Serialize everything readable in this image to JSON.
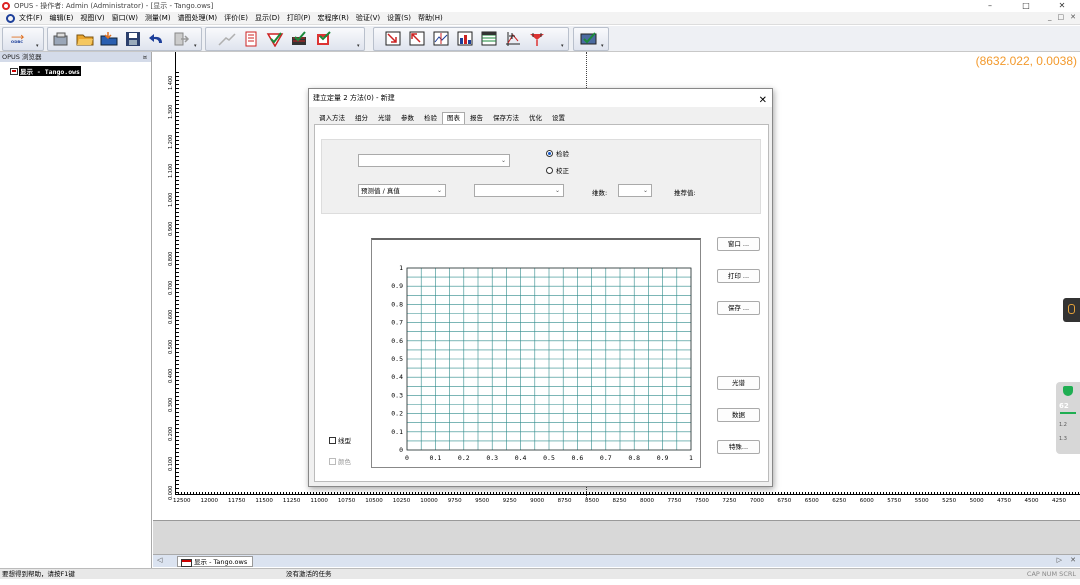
{
  "window": {
    "title": "OPUS - 操作者: Admin  (Administrator) - [显示 - Tango.ows]",
    "controls": [
      "–",
      "□",
      "✕"
    ],
    "mdi_controls": [
      "_",
      "□",
      "✕"
    ]
  },
  "menu": [
    "文件(F)",
    "编辑(E)",
    "视图(V)",
    "窗口(W)",
    "测量(M)",
    "谱图处理(M)",
    "评价(E)",
    "显示(D)",
    "打印(P)",
    "宏程序(R)",
    "验证(V)",
    "设置(S)",
    "帮助(H)"
  ],
  "toolbar": {
    "odbc_label": "ODBC"
  },
  "browser": {
    "header": "OPUS 浏览器",
    "pin": "¤",
    "item": "显示 - Tango.ows"
  },
  "spectrum": {
    "readout": "(8632.022, 0.0038)",
    "y_ticks": [
      "1.400",
      "1.300",
      "1.200",
      "1.100",
      "1.000",
      "0.900",
      "0.800",
      "0.700",
      "0.600",
      "0.500",
      "0.400",
      "0.300",
      "0.200",
      "0.100",
      "0.000"
    ],
    "x_ticks": [
      "12500",
      "12000",
      "11750",
      "11500",
      "11250",
      "11000",
      "10750",
      "10500",
      "10250",
      "10000",
      "9750",
      "9500",
      "9250",
      "9000",
      "8750",
      "8500",
      "8250",
      "8000",
      "7750",
      "7500",
      "7250",
      "7000",
      "6750",
      "6500",
      "6250",
      "6000",
      "5750",
      "5500",
      "5250",
      "5000",
      "4750",
      "4500",
      "4250"
    ]
  },
  "doc_tabs": {
    "active": "显示 - Tango.ows",
    "left_arrow": "◁",
    "right_arrow": "▷",
    "close": "✕"
  },
  "statusbar": {
    "help": "要想得到帮助，请按F1键",
    "task": "没有激活的任务",
    "indicators": "CAP  NUM  SCRL"
  },
  "net_widget": {
    "percent": "62",
    "up": "1.2",
    "down": "1.3"
  },
  "dialog": {
    "title": "建立定量 2 方法(0)  -  新建",
    "close": "✕",
    "tabs": [
      "调入方法",
      "组分",
      "光谱",
      "参数",
      "检验",
      "图表",
      "报告",
      "保存方法",
      "优化",
      "设置"
    ],
    "active_tab_index": 5,
    "radio_validation": "检验",
    "radio_calibration": "校正",
    "combo_plot_type": "预测值 / 真值",
    "label_dimensions": "维数:",
    "label_recommended": "推荐值:",
    "buttons": {
      "window": "窗口 ...",
      "print": "打印 ...",
      "save": "保存 ...",
      "spectrum": "光谱",
      "data": "数据",
      "special": "特殊..."
    },
    "checkbox_line": "线型",
    "checkbox_color": "颜色"
  },
  "chart_data": {
    "type": "scatter",
    "x_ticks": [
      "0",
      "0.1",
      "0.2",
      "0.3",
      "0.4",
      "0.5",
      "0.6",
      "0.7",
      "0.8",
      "0.9",
      "1"
    ],
    "y_ticks": [
      "0",
      "0.1",
      "0.2",
      "0.3",
      "0.4",
      "0.5",
      "0.6",
      "0.7",
      "0.8",
      "0.9",
      "1"
    ],
    "xlim": [
      0,
      1
    ],
    "ylim": [
      0,
      1
    ],
    "grid": true,
    "grid_color": "#2e8b8b",
    "points": []
  },
  "colors": {
    "readout": "#f39a2d",
    "accent": "#1559c7",
    "grid": "#2e8b8b"
  }
}
